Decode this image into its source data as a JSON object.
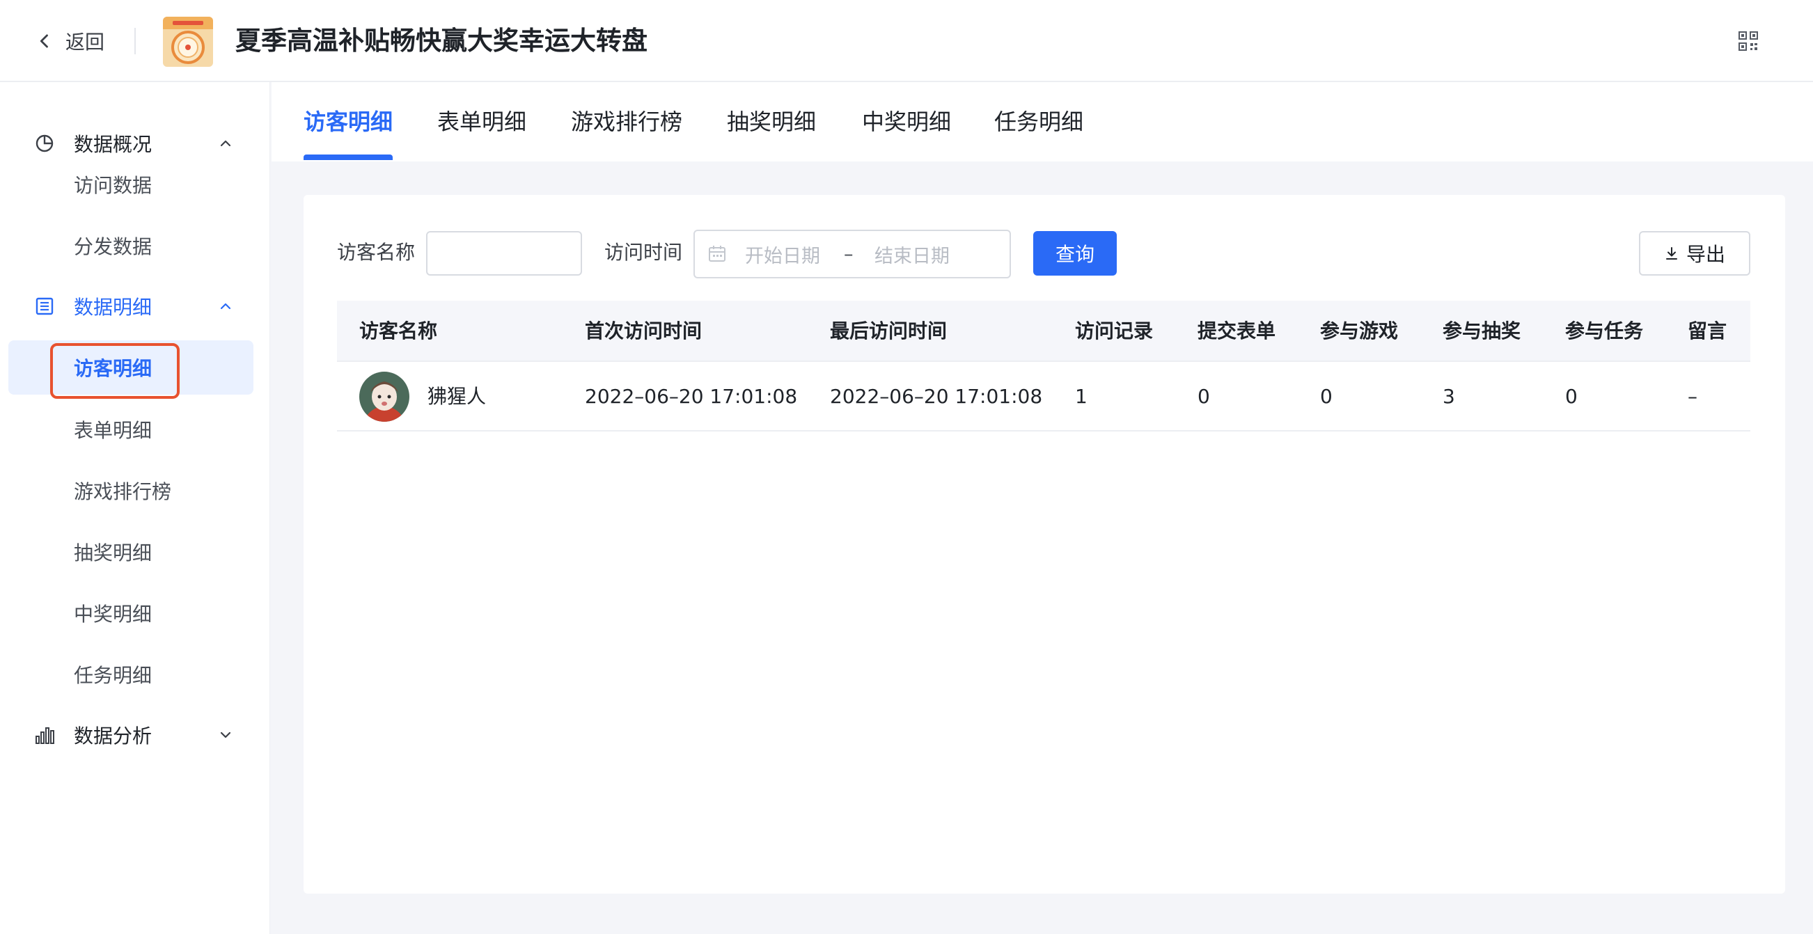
{
  "header": {
    "back_label": "返回",
    "title": "夏季高温补贴畅快赢大奖幸运大转盘"
  },
  "sidebar": {
    "groups": [
      {
        "label": "数据概况",
        "icon": "pie-chart-icon",
        "expanded": true,
        "items": [
          "访问数据",
          "分发数据"
        ]
      },
      {
        "label": "数据明细",
        "icon": "list-icon",
        "expanded": true,
        "items": [
          "访客明细",
          "表单明细",
          "游戏排行榜",
          "抽奖明细",
          "中奖明细",
          "任务明细"
        ]
      },
      {
        "label": "数据分析",
        "icon": "bar-chart-icon",
        "expanded": false,
        "items": []
      }
    ],
    "active_item": "访客明细"
  },
  "tabs": [
    "访客明细",
    "表单明细",
    "游戏排行榜",
    "抽奖明细",
    "中奖明细",
    "任务明细"
  ],
  "active_tab": "访客明细",
  "filters": {
    "visitor_name_label": "访客名称",
    "visitor_name_value": "",
    "visit_time_label": "访问时间",
    "start_placeholder": "开始日期",
    "separator": "–",
    "end_placeholder": "结束日期",
    "query_label": "查询",
    "export_label": "导出"
  },
  "table": {
    "columns": [
      "访客名称",
      "首次访问时间",
      "最后访问时间",
      "访问记录",
      "提交表单",
      "参与游戏",
      "参与抽奖",
      "参与任务",
      "留言"
    ],
    "rows": [
      {
        "name": "狒猩人",
        "first_visit": "2022–06–20 17:01:08",
        "last_visit": "2022–06–20 17:01:08",
        "visits": "1",
        "forms": "0",
        "games": "0",
        "lottery": "3",
        "tasks": "0",
        "message": "–"
      }
    ]
  },
  "colors": {
    "accent": "#2a6af6",
    "highlight_box": "#e8522f",
    "active_item_bg": "#eaf1ff"
  }
}
